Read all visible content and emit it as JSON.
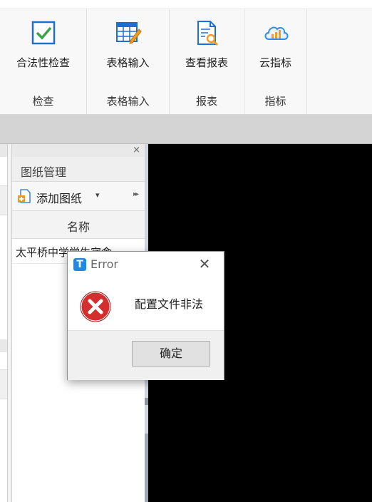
{
  "ribbon": {
    "groups": [
      {
        "label": "检查",
        "buttons": [
          {
            "label": "合法性检查",
            "icon": "checkbox-icon"
          }
        ]
      },
      {
        "label": "表格输入",
        "buttons": [
          {
            "label": "表格输入",
            "icon": "table-edit-icon"
          }
        ]
      },
      {
        "label": "报表",
        "buttons": [
          {
            "label": "查看报表",
            "icon": "report-search-icon"
          }
        ]
      },
      {
        "label": "指标",
        "buttons": [
          {
            "label": "云指标",
            "icon": "cloud-chart-icon"
          }
        ]
      }
    ]
  },
  "panel": {
    "title": "图纸管理",
    "close": "×",
    "add_button": "添加图纸",
    "add_caret": "▾",
    "more": "▸▸",
    "column_header": "名称",
    "rows": [
      "太平桥中学学生宿舍"
    ]
  },
  "dialog": {
    "app_icon": "T",
    "title": "Error",
    "close": "✕",
    "message": "配置文件非法",
    "ok": "确定"
  },
  "colors": {
    "accent": "#1e88e5",
    "error_red": "#d32f2f",
    "check_green": "#3aa348",
    "canvas": "#000000"
  }
}
